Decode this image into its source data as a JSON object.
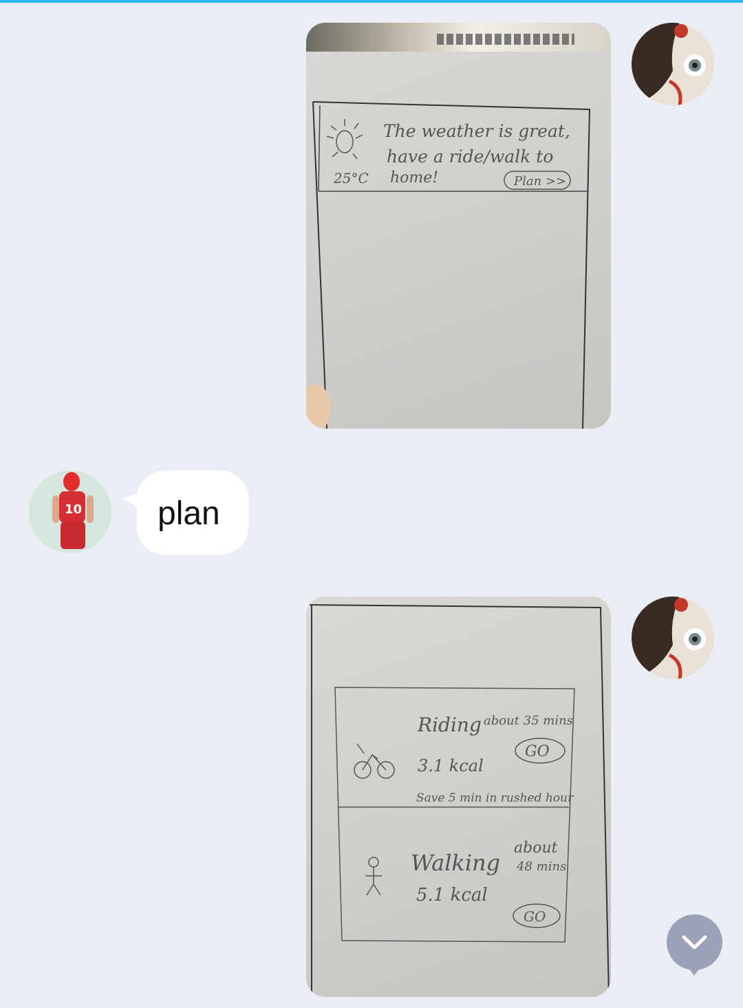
{
  "chat": {
    "messages": [
      {
        "side": "right",
        "type": "image",
        "sketch": {
          "weather_line1": "The weather is great,",
          "weather_line2": "have a ride/walk to",
          "weather_line3": "home!",
          "temperature": "25°C",
          "plan_button": "Plan >>"
        }
      },
      {
        "side": "left",
        "type": "text",
        "text": "plan"
      },
      {
        "side": "right",
        "type": "image",
        "sketch": {
          "riding_title": "Riding",
          "riding_time": "about 35 mins",
          "riding_kcal": "3.1 kcal",
          "riding_note": "Save 5 min in rushed hour",
          "go_label": "GO",
          "walking_title": "Walking",
          "walking_time_1": "about",
          "walking_time_2": "48 mins",
          "walking_kcal": "5.1 kcal",
          "walking_go": "GO"
        }
      }
    ]
  },
  "colors": {
    "accent_line": "#2cb6ee",
    "background": "#ebedf5",
    "scroll_button": "#9aa1b8"
  },
  "icons": {
    "scroll_down": "chevron-down-icon"
  }
}
